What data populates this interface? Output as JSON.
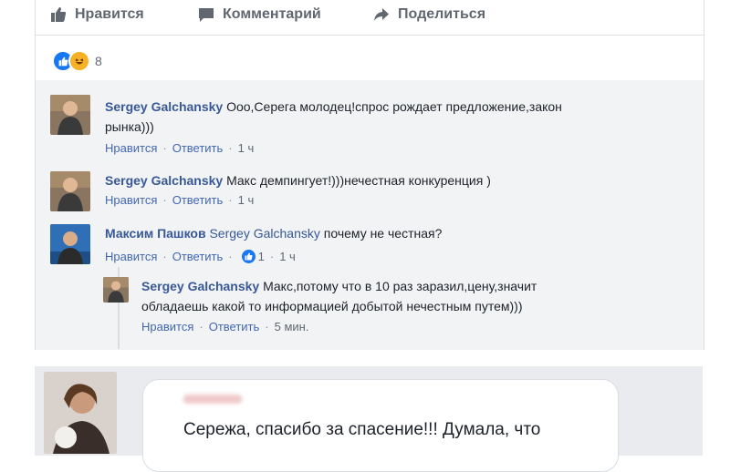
{
  "actions": {
    "like": "Нравится",
    "comment": "Комментарий",
    "share": "Поделиться"
  },
  "reactions": {
    "count": "8"
  },
  "comments": [
    {
      "author": "Sergey Galchansky",
      "text": "Ооо,Серега молодец!спрос рождает предложение,закон",
      "text2": "рынка)))",
      "like": "Нравится",
      "reply": "Ответить",
      "time": "1 ч"
    },
    {
      "author": "Sergey Galchansky",
      "text": "Макс демпингует!)))нечестная конкуренция )",
      "like": "Нравится",
      "reply": "Ответить",
      "time": "1 ч"
    },
    {
      "author": "Максим Пашков",
      "mention": "Sergey Galchansky",
      "text": "почему не честная?",
      "like": "Нравится",
      "reply": "Ответить",
      "likes": "1",
      "time": "1 ч"
    },
    {
      "author": "Sergey Galchansky",
      "text": "Макс,потому что в 10 раз заразил,цену,значит",
      "text2": "обладаешь какой то информацией добытой нечестным путем)))",
      "like": "Нравится",
      "reply": "Ответить",
      "time": "5 мин."
    }
  ],
  "bottom": {
    "text": "Сережа, спасибо за спасение!!! Думала, что"
  }
}
